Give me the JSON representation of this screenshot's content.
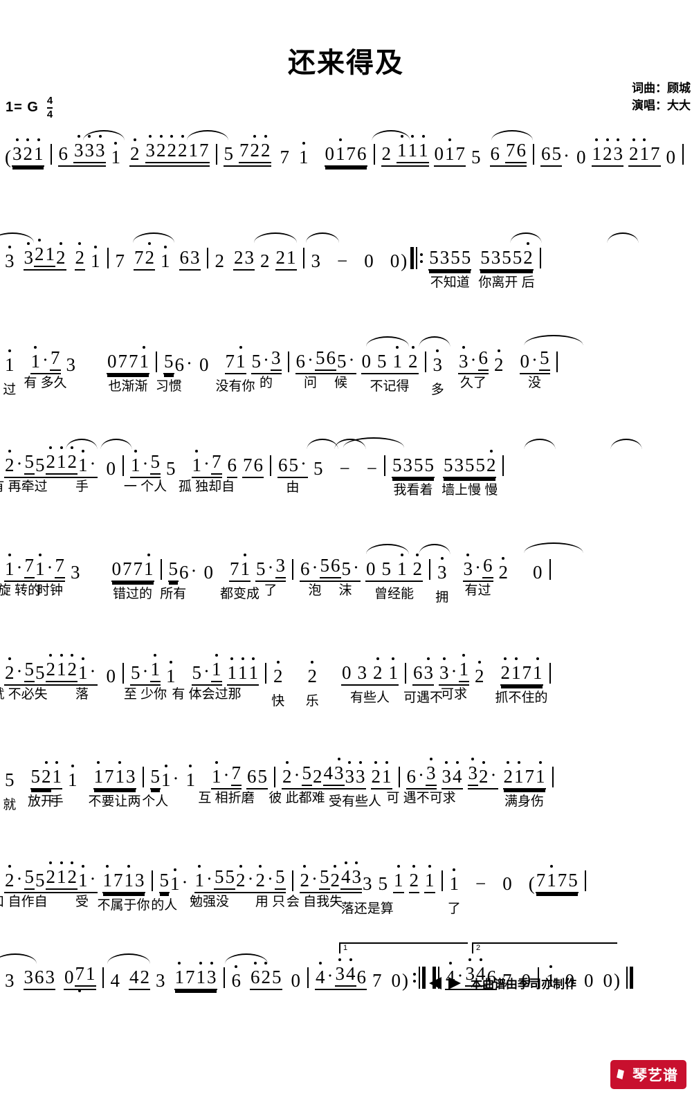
{
  "header": {
    "title": "还来得及",
    "composer_label": "词曲：顾城",
    "singer_label": "演唱：大大",
    "key_signature": "1= G",
    "time_numerator": "4",
    "time_denominator": "4"
  },
  "footer": {
    "credit_text": "本曲谱由季司亦制作",
    "watermark": "琴艺谱"
  },
  "music": {
    "lines": [
      {
        "id": "line-1",
        "notation": "(321 | 6 3331 2 322217 | 5 7227 1 | 0176 | 2 1111 0175 6 76 | 65· 0 123 2170 |",
        "lyrics": ""
      },
      {
        "id": "line-2",
        "notation": "3 32122 21 | 7 7221 63 | 2 2232 21 | 3 - 0 0) ||: 5355 53552 |",
        "lyrics": "不知道 你离开 后"
      },
      {
        "id": "line-3",
        "notation": "1 1·73 0771 | 56·0 715·3 | 6·5 65·0 512 | 3 3·62 0·5 |",
        "lyrics": "过 有 多久 也渐渐 习惯 没有你 的 问 候 不记得 多 久了 没"
      },
      {
        "id": "line-4",
        "notation": "2·55 21 21· 0 | 1·55 1·7676 | 65·5 - - | 5355 53552 |",
        "lyrics": "有 再牵过 手 一 个人 孤 独却自 由 我看着 墙上慢 慢"
      },
      {
        "id": "line-5",
        "notation": "1·71·73 0771 | 56·0 715·3 | 6·565·0 512 | 3 3·62 0 |",
        "lyrics": "旋 转的 时钟 错过的 所有 都变成 了 泡 沫 曾经能 拥 有过"
      },
      {
        "id": "line-6",
        "notation": "2·55 21 21· 0 | 5·11 5·1111 | 2 2 0321 | 63 3·12 2171 |",
        "lyrics": "就 不必失 落 至 少你 有 体会过那 快 乐 有些人 可遇不 可求 抓不住的"
      },
      {
        "id": "line-7",
        "notation": "5 5211 1713 | 51·1 1·765 | 2·52433321 | 6·334 32·2171 |",
        "lyrics": "就 放开 手 不要让两 个人 互 相折磨 彼 此都难 受有些人 可 遇不可求 满身伤"
      },
      {
        "id": "line-8",
        "notation": "2·55 21 21· 1713 | 51·1·552·2·5 | 2·52433 5121 | 1 - 0 (7175",
        "lyrics": "口 自作自 受 不属于你 的人 勉强没 用 只 会 自我失 落还是算 了"
      },
      {
        "id": "line-9",
        "notation": "3 363 071 | 4 423 1713 | 6 625 0 | 4·3467 0) :|| 4·3467 0 | 1 0 0 0) ||",
        "lyrics": ""
      }
    ],
    "volta_1_label": "1",
    "volta_2_label": "2"
  }
}
